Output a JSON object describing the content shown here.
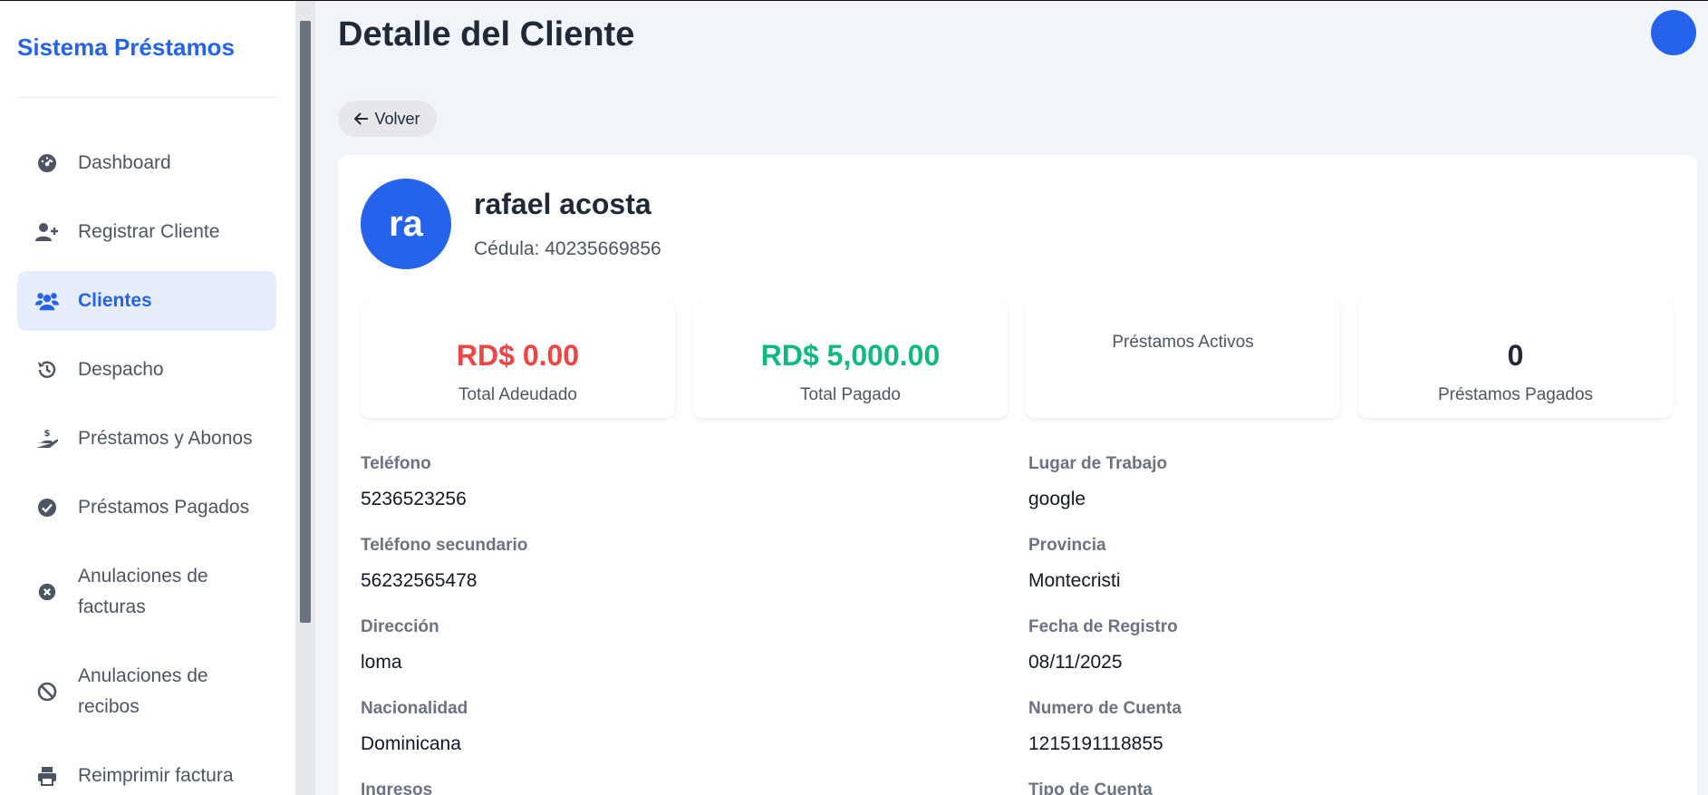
{
  "sidebar": {
    "brand": "Sistema Préstamos",
    "items": [
      {
        "label": "Dashboard",
        "icon": "dashboard-gauge-icon"
      },
      {
        "label": "Registrar Cliente",
        "icon": "user-plus-icon"
      },
      {
        "label": "Clientes",
        "icon": "users-icon",
        "active": true
      },
      {
        "label": "Despacho",
        "icon": "history-icon"
      },
      {
        "label": "Préstamos y Abonos",
        "icon": "hand-dollar-icon"
      },
      {
        "label": "Préstamos Pagados",
        "icon": "check-circle-icon"
      },
      {
        "label": "Anulaciones de facturas",
        "icon": "x-circle-icon"
      },
      {
        "label": "Anulaciones de recibos",
        "icon": "ban-icon"
      },
      {
        "label": "Reimprimir factura",
        "icon": "printer-icon"
      }
    ]
  },
  "header": {
    "title": "Detalle del Cliente",
    "back_label": "Volver"
  },
  "client": {
    "initials": "ra",
    "name": "rafael acosta",
    "id_line": "Cédula: 40235669856"
  },
  "stats": [
    {
      "value": "RD$ 0.00",
      "label": "Total Adeudado",
      "color": "#ef4444"
    },
    {
      "value": "RD$ 5,000.00",
      "label": "Total Pagado",
      "color": "#10b981"
    },
    {
      "value": "",
      "label": "Préstamos Activos",
      "color": "#1f2937"
    },
    {
      "value": "0",
      "label": "Préstamos Pagados",
      "color": "#1f2937"
    }
  ],
  "fields_left": [
    {
      "label": "Teléfono",
      "value": "5236523256"
    },
    {
      "label": "Teléfono secundario",
      "value": "56232565478"
    },
    {
      "label": "Dirección",
      "value": "loma"
    },
    {
      "label": "Nacionalidad",
      "value": "Dominicana"
    },
    {
      "label": "Ingresos",
      "value": ""
    }
  ],
  "fields_right": [
    {
      "label": "Lugar de Trabajo",
      "value": "google"
    },
    {
      "label": "Provincia",
      "value": "Montecristi"
    },
    {
      "label": "Fecha de Registro",
      "value": "08/11/2025"
    },
    {
      "label": "Numero de Cuenta",
      "value": "1215191118855"
    },
    {
      "label": "Tipo de Cuenta",
      "value": ""
    }
  ],
  "colors": {
    "accent": "#2563eb",
    "danger": "#ef4444",
    "success": "#10b981"
  }
}
